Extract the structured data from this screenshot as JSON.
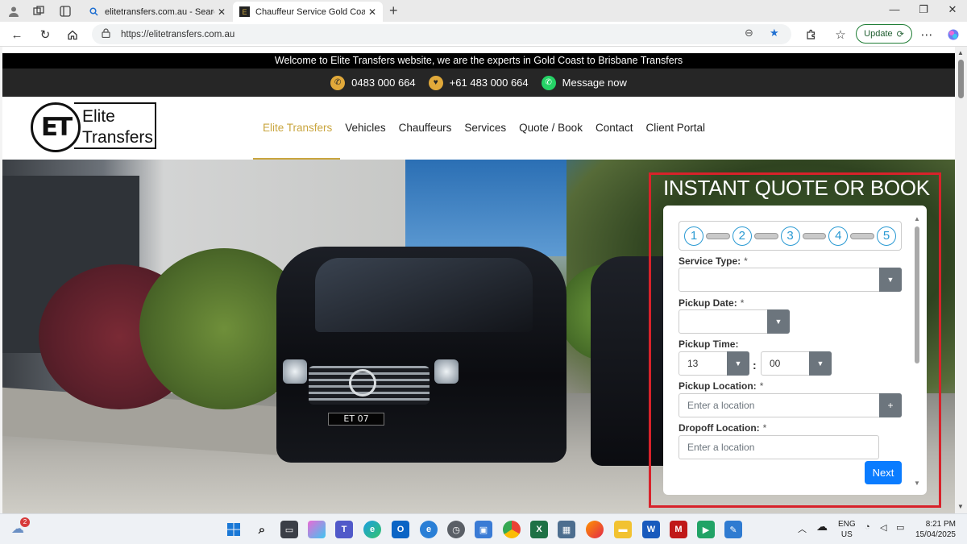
{
  "browser": {
    "tabs": [
      {
        "title": "elitetransfers.com.au - Search",
        "active": false
      },
      {
        "title": "Chauffeur Service Gold Coast, Bris",
        "active": true
      }
    ],
    "url": "https://elitetransfers.com.au",
    "update_label": "Update"
  },
  "site": {
    "welcome_text": "Welcome to Elite Transfers website, we are the experts in Gold Coast to Brisbane Transfers",
    "contact": {
      "phone": "0483 000 664",
      "intl_phone": "+61 483 000 664",
      "message": "Message now"
    },
    "logo": {
      "mark": "ET",
      "line1": "Elite",
      "line2": "Transfers"
    },
    "menu": [
      {
        "label": "Elite Transfers",
        "active": true
      },
      {
        "label": "Vehicles",
        "active": false
      },
      {
        "label": "Chauffeurs",
        "active": false
      },
      {
        "label": "Services",
        "active": false
      },
      {
        "label": "Quote / Book",
        "active": false
      },
      {
        "label": "Contact",
        "active": false
      },
      {
        "label": "Client Portal",
        "active": false
      }
    ],
    "plate_text": "ET 07",
    "quote": {
      "title": "INSTANT QUOTE OR BOOK",
      "steps": [
        "1",
        "2",
        "3",
        "4",
        "5"
      ],
      "service_type_label": "Service Type:",
      "pickup_date_label": "Pickup Date:",
      "pickup_time_label": "Pickup Time:",
      "pickup_hour": "13",
      "pickup_minute": "00",
      "time_separator": ":",
      "pickup_location_label": "Pickup Location:",
      "pickup_location_placeholder": "Enter a location",
      "dropoff_location_label": "Dropoff Location:",
      "dropoff_location_placeholder": "Enter a location",
      "required_mark": "*",
      "plus_label": "+",
      "next_label": "Next"
    }
  },
  "taskbar": {
    "notification_count": "2",
    "language": "ENG",
    "region": "US",
    "time": "8:21 PM",
    "date": "15/04/2025"
  },
  "colors": {
    "accent_gold": "#c9a53e",
    "frame_red": "#d8222a",
    "next_blue": "#0a7cff",
    "step_blue": "#2a9ad3"
  }
}
